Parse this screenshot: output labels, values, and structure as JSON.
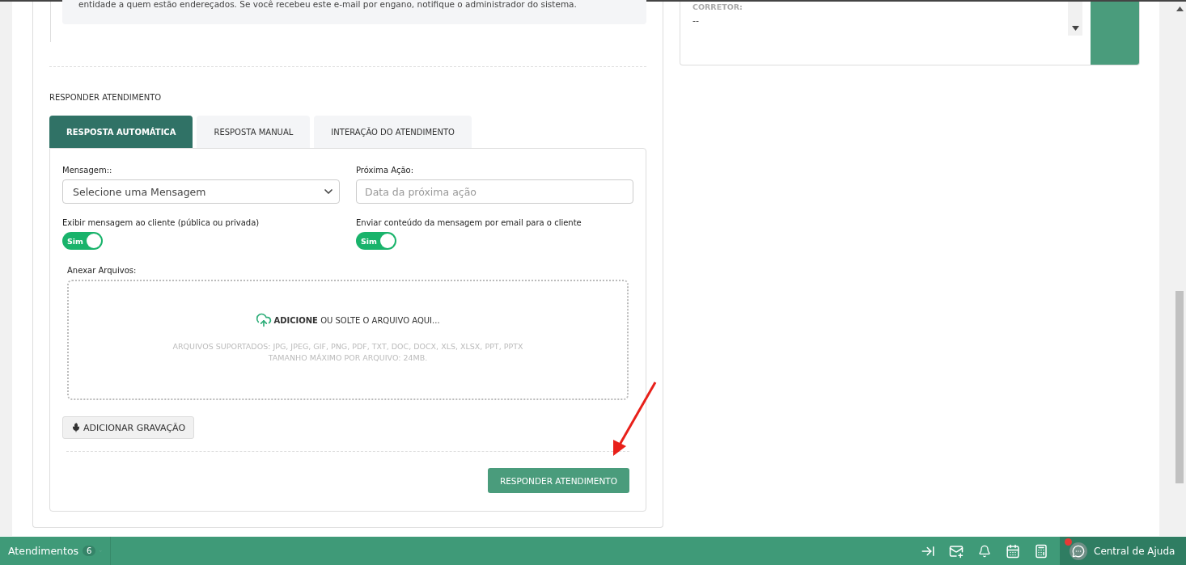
{
  "email_notice": {
    "text": "entidade a quem estão endereçados. Se você recebeu este e-mail por engano, notifique o administrador do sistema."
  },
  "right_panel": {
    "field_label": "CORRETOR:",
    "field_value": "--"
  },
  "section_title": "RESPONDER ATENDIMENTO",
  "tabs": [
    {
      "label": "RESPOSTA AUTOMÁTICA",
      "selected": true
    },
    {
      "label": "RESPOSTA MANUAL",
      "selected": false
    },
    {
      "label": "INTERAÇÃO DO ATENDIMENTO",
      "selected": false
    }
  ],
  "form": {
    "message": {
      "label": "Mensagem::",
      "value": "Selecione uma Mensagem"
    },
    "next_action": {
      "label": "Próxima Ação:",
      "placeholder": "Data da próxima ação"
    },
    "toggles": [
      {
        "label": "Exibir mensagem ao cliente (pública ou privada)",
        "on": true,
        "text": "Sim"
      },
      {
        "label": "Enviar conteúdo da mensagem por email para o cliente",
        "on": true,
        "text": "Sim"
      }
    ],
    "attachments": {
      "label": "Anexar Arquivos:",
      "prompt": "**ADICIONE** OU SOLTE O ARQUIVO AQUI...",
      "supported": "ARQUIVOS SUPORTADOS: JPG, JPEG, GIF, PNG, PDF, TXT, DOC, DOCX, XLS, XLSX, PPT, PPTX",
      "max_size": "TAMANHO MÁXIMO POR ARQUIVO: 24MB."
    },
    "record_button": "ADICIONAR GRAVAÇÃO",
    "submit_button": "RESPONDER ATENDIMENTO"
  },
  "bottom_bar": {
    "queue_label": "Atendimentos",
    "queue_count": "6",
    "help_label": "Central de Ajuda",
    "help_notification": true
  }
}
